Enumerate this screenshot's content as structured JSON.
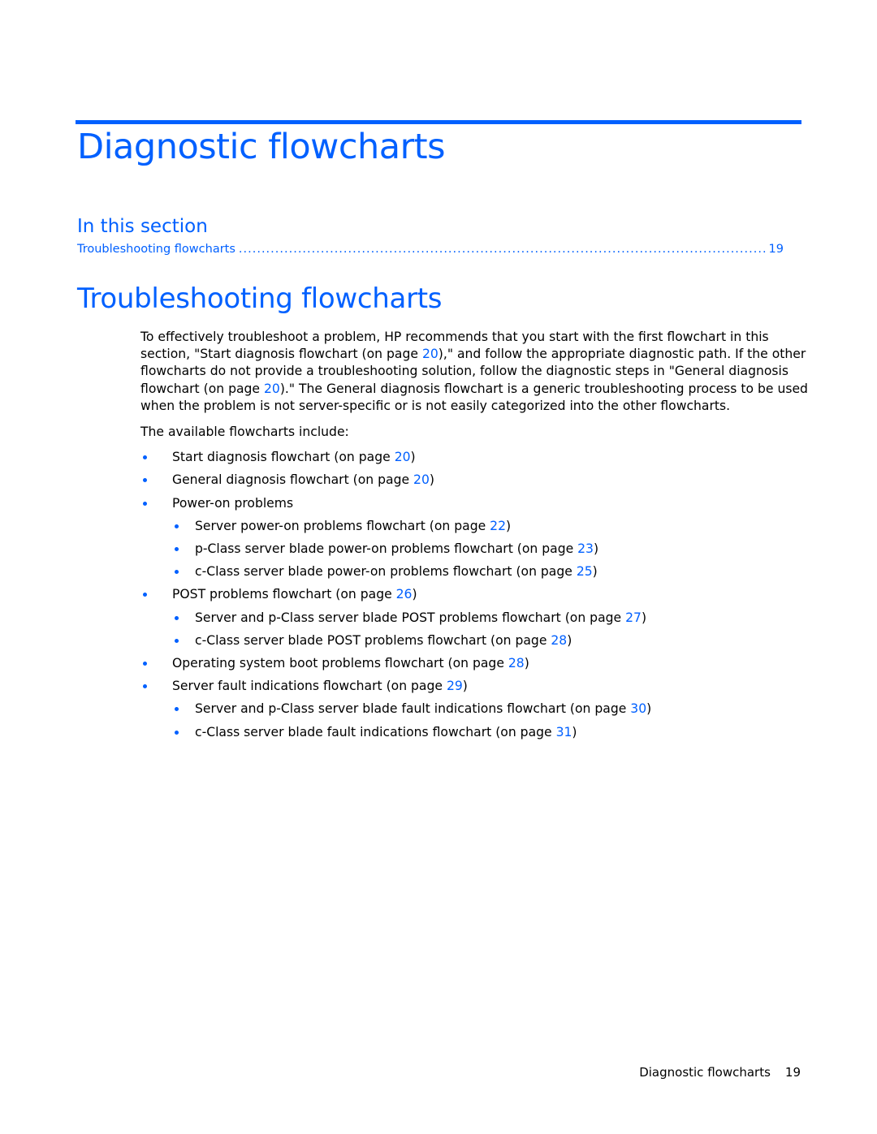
{
  "chapter": {
    "title": "Diagnostic flowcharts"
  },
  "in_this_section": {
    "heading": "In this section",
    "toc": [
      {
        "label": "Troubleshooting flowcharts",
        "page": "19"
      }
    ]
  },
  "section": {
    "title": "Troubleshooting flowcharts",
    "intro": {
      "t1": "To effectively troubleshoot a problem, HP recommends that you start with the first flowchart in this section, \"Start diagnosis flowchart (on page ",
      "l1": "20",
      "t2": "),\" and follow the appropriate diagnostic path. If the other flowcharts do not provide a troubleshooting solution, follow the diagnostic steps in \"General diagnosis flowchart (on page ",
      "l2": "20",
      "t3": ").\" The General diagnosis flowchart is a generic troubleshooting process to be used when the problem is not server-specific or is not easily categorized into the other flowcharts."
    },
    "list_intro": "The available flowcharts include:",
    "items": [
      {
        "text": "Start diagnosis flowchart (on page ",
        "page": "20",
        "close": ")"
      },
      {
        "text": "General diagnosis flowchart (on page ",
        "page": "20",
        "close": ")"
      },
      {
        "text": "Power-on problems",
        "children": [
          {
            "text": "Server power-on problems flowchart (on page ",
            "page": "22",
            "close": ")"
          },
          {
            "text": "p-Class server blade power-on problems flowchart (on page ",
            "page": "23",
            "close": ")"
          },
          {
            "text": "c-Class server blade power-on problems flowchart (on page ",
            "page": "25",
            "close": ")"
          }
        ]
      },
      {
        "text": "POST problems flowchart (on page ",
        "page": "26",
        "close": ")",
        "children": [
          {
            "text": "Server and p-Class server blade POST problems flowchart (on page ",
            "page": "27",
            "close": ")"
          },
          {
            "text": "c-Class server blade POST problems flowchart (on page ",
            "page": "28",
            "close": ")"
          }
        ]
      },
      {
        "text": "Operating system boot problems flowchart (on page ",
        "page": "28",
        "close": ")"
      },
      {
        "text": "Server fault indications flowchart (on page ",
        "page": "29",
        "close": ")",
        "children": [
          {
            "text": "Server and p-Class server blade fault indications flowchart (on page ",
            "page": "30",
            "close": ")"
          },
          {
            "text": "c-Class server blade fault indications flowchart (on page ",
            "page": "31",
            "close": ")"
          }
        ]
      }
    ]
  },
  "footer": {
    "section": "Diagnostic flowcharts",
    "page": "19"
  },
  "colors": {
    "accent": "#0060ff",
    "text": "#000000"
  }
}
